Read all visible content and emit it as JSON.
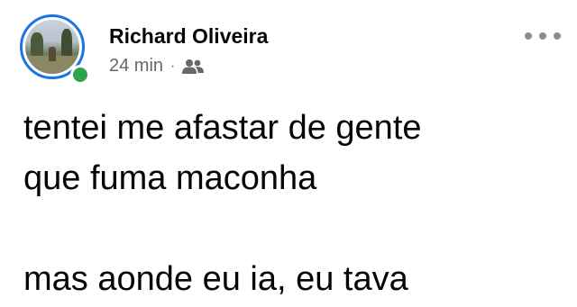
{
  "post": {
    "author_name": "Richard Oliveira",
    "timestamp": "24 min",
    "separator": "·",
    "audience_icon": "friends-icon",
    "more_icon": "more-options-icon",
    "online_status_color": "#31a24c",
    "story_ring_color": "#1b74e4",
    "text_lines": [
      "tentei me afastar de gente",
      "que fuma maconha",
      "",
      "mas aonde eu ia, eu tava"
    ]
  }
}
